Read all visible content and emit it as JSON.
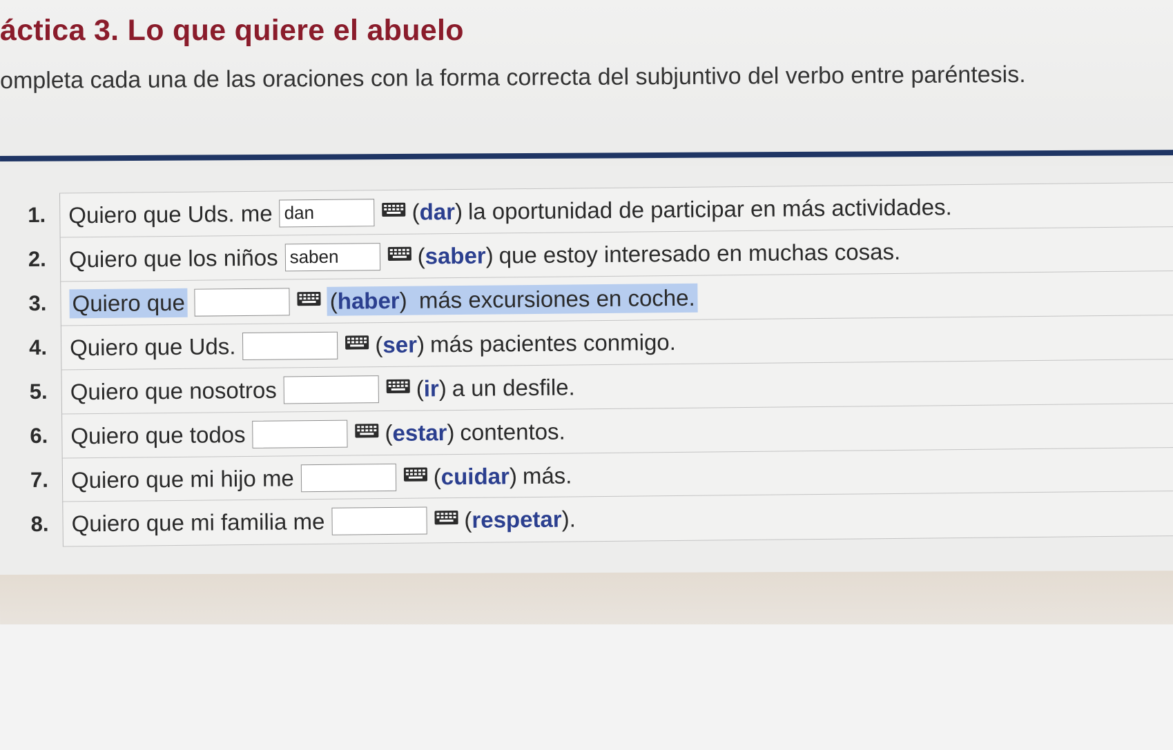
{
  "header": {
    "title": "áctica 3. Lo que quiere el abuelo",
    "instructions": "ompleta cada una de las oraciones con la forma correcta del subjuntivo del verbo entre paréntesis."
  },
  "items": [
    {
      "number": "1.",
      "prefix": "Quiero que Uds. me",
      "value": "dan",
      "verb": "dar",
      "suffix": "la oportunidad de participar en más actividades."
    },
    {
      "number": "2.",
      "prefix": "Quiero que los niños",
      "value": "saben",
      "verb": "saber",
      "suffix": "que estoy interesado en muchas cosas."
    },
    {
      "number": "3.",
      "prefix": "Quiero que",
      "value": "",
      "verb": "haber",
      "suffix": "más excursiones en coche."
    },
    {
      "number": "4.",
      "prefix": "Quiero que Uds.",
      "value": "",
      "verb": "ser",
      "suffix": "más pacientes conmigo."
    },
    {
      "number": "5.",
      "prefix": "Quiero que nosotros",
      "value": "",
      "verb": "ir",
      "suffix": "a un desfile."
    },
    {
      "number": "6.",
      "prefix": "Quiero que todos",
      "value": "",
      "verb": "estar",
      "suffix": "contentos."
    },
    {
      "number": "7.",
      "prefix": "Quiero que mi hijo me",
      "value": "",
      "verb": "cuidar",
      "suffix": "más."
    },
    {
      "number": "8.",
      "prefix": "Quiero que mi familia me",
      "value": "",
      "verb": "respetar",
      "suffix": "."
    }
  ],
  "punctuation": {
    "open": "(",
    "close": ")"
  },
  "icons": {
    "keyboard": "keyboard-icon"
  },
  "colors": {
    "title": "#8a1c2b",
    "verb": "#2b3f8f",
    "divider": "#1f3564",
    "selection": "#b7cdef"
  }
}
